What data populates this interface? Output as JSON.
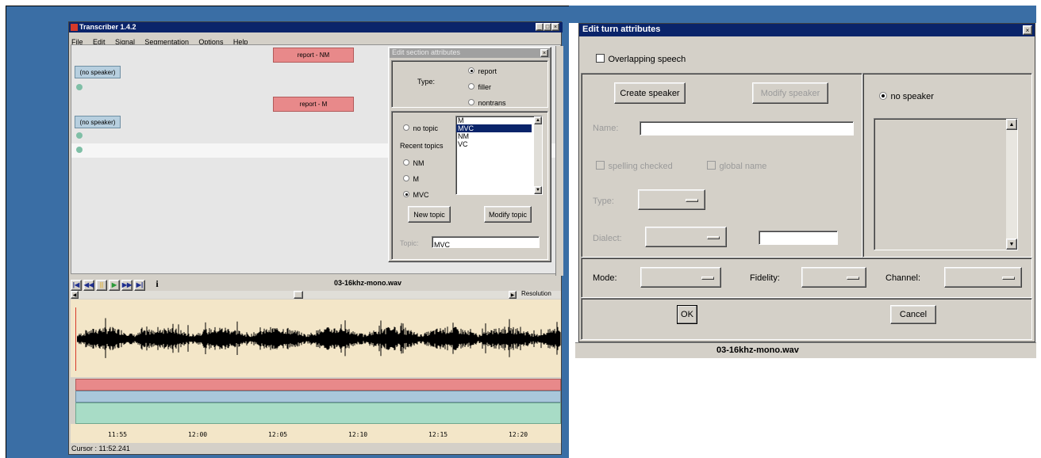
{
  "transcriber": {
    "title": "Transcriber 1.4.2",
    "menu": [
      "File",
      "Edit",
      "Signal",
      "Segmentation",
      "Options",
      "Help"
    ],
    "sections": [
      "report - NM",
      "report - M"
    ],
    "speakers": [
      "(no speaker)",
      "(no speaker)"
    ],
    "filename": "03-16khz-mono.wav",
    "scroll_label": "Resolution",
    "time_ticks": [
      "11:55",
      "12:00",
      "12:05",
      "12:10",
      "12:15",
      "12:20"
    ],
    "cursor": "Cursor : 11:52.241",
    "colors": {
      "section": "#e8898a",
      "speaker": "#b7cfdf",
      "turn": "#a8dcc6",
      "wave_bg": "#f3e6c8"
    }
  },
  "section_dialog": {
    "title": "Edit section attributes",
    "type_label": "Type:",
    "types": [
      {
        "label": "report",
        "selected": true
      },
      {
        "label": "filler",
        "selected": false
      },
      {
        "label": "nontrans",
        "selected": false
      }
    ],
    "no_topic": "no topic",
    "recent_label": "Recent topics",
    "recent_topics": [
      {
        "label": "NM",
        "selected": false
      },
      {
        "label": "M",
        "selected": false
      },
      {
        "label": "MVC",
        "selected": true
      }
    ],
    "topic_list": [
      "M",
      "MVC",
      "NM",
      "VC"
    ],
    "topic_list_selected": "MVC",
    "new_topic": "New topic",
    "modify_topic": "Modify topic",
    "topic_label": "Topic:",
    "topic_value": "MVC"
  },
  "turn_dialog": {
    "title": "Edit turn attributes",
    "overlapping": "Overlapping speech",
    "create_speaker": "Create speaker",
    "modify_speaker": "Modify speaker",
    "no_speaker": "no speaker",
    "name_label": "Name:",
    "name_value": "",
    "spelling_checked": "spelling checked",
    "global_name": "global name",
    "type_label": "Type:",
    "dialect_label": "Dialect:",
    "mode_label": "Mode:",
    "fidelity_label": "Fidelity:",
    "channel_label": "Channel:",
    "ok": "OK",
    "cancel": "Cancel",
    "filename": "03-16khz-mono.wav"
  }
}
